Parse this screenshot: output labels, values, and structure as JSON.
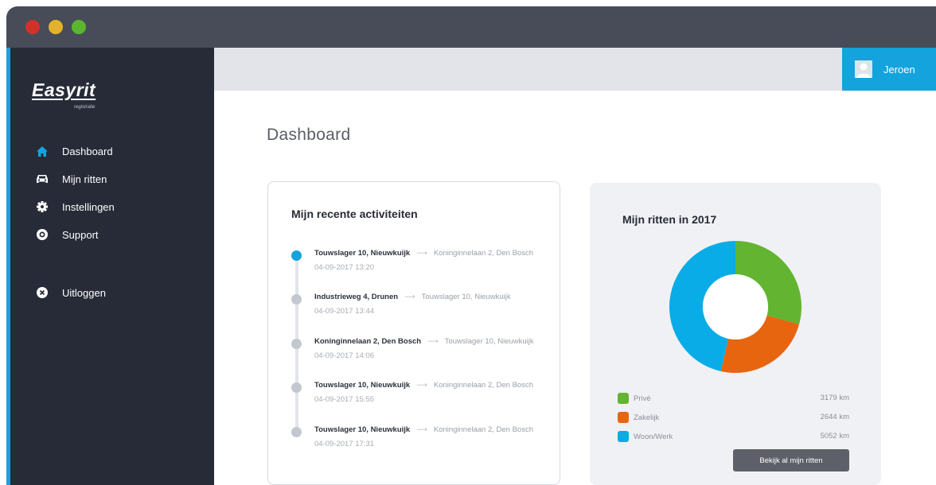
{
  "app": {
    "logo": "Easyrit",
    "logo_sub": "registratie"
  },
  "sidebar": {
    "items": [
      {
        "label": "Dashboard",
        "icon": "home-icon",
        "color": "#14a3dd"
      },
      {
        "label": "Mijn ritten",
        "icon": "car-icon",
        "color": "#ffffff"
      },
      {
        "label": "Instellingen",
        "icon": "gear-icon",
        "color": "#ffffff"
      },
      {
        "label": "Support",
        "icon": "support-icon",
        "color": "#ffffff"
      },
      {
        "label": "Uitloggen",
        "icon": "logout-icon",
        "color": "#ffffff"
      }
    ]
  },
  "header": {
    "user_name": "Jeroen"
  },
  "main": {
    "title": "Dashboard",
    "activity": {
      "title": "Mijn recente activiteiten",
      "items": [
        {
          "from": "Touwslager 10, Nieuwkuijk",
          "to": "Koninginnelaan 2, Den Bosch",
          "time": "04-09-2017 13:20",
          "active": true
        },
        {
          "from": "Industrieweg 4, Drunen",
          "to": "Touwslager 10, Nieuwkuijk",
          "time": "04-09-2017 13:44",
          "active": false
        },
        {
          "from": "Koninginnelaan 2, Den Bosch",
          "to": "Touwslager 10, Nieuwkuijk",
          "time": "04-09-2017 14:06",
          "active": false
        },
        {
          "from": "Touwslager 10, Nieuwkuijk",
          "to": "Koninginnelaan 2, Den Bosch",
          "time": "04-09-2017 15:55",
          "active": false
        },
        {
          "from": "Touwslager 10, Nieuwkuijk",
          "to": "Koninginnelaan 2, Den Bosch",
          "time": "04-09-2017 17:31",
          "active": false
        }
      ]
    },
    "rides": {
      "title": "Mijn ritten in 2017",
      "button_label": "Bekijk al mijn ritten"
    }
  },
  "chart_data": {
    "type": "pie",
    "title": "Mijn ritten in 2017",
    "categories": [
      "Privé",
      "Zakelijk",
      "Woon/Werk"
    ],
    "values": [
      3179,
      2644,
      5052
    ],
    "value_labels": [
      "3179 km",
      "2644 km",
      "5052 km"
    ],
    "colors": [
      "#63b531",
      "#e8650f",
      "#09ace6"
    ],
    "donut": true,
    "legend_position": "bottom"
  }
}
